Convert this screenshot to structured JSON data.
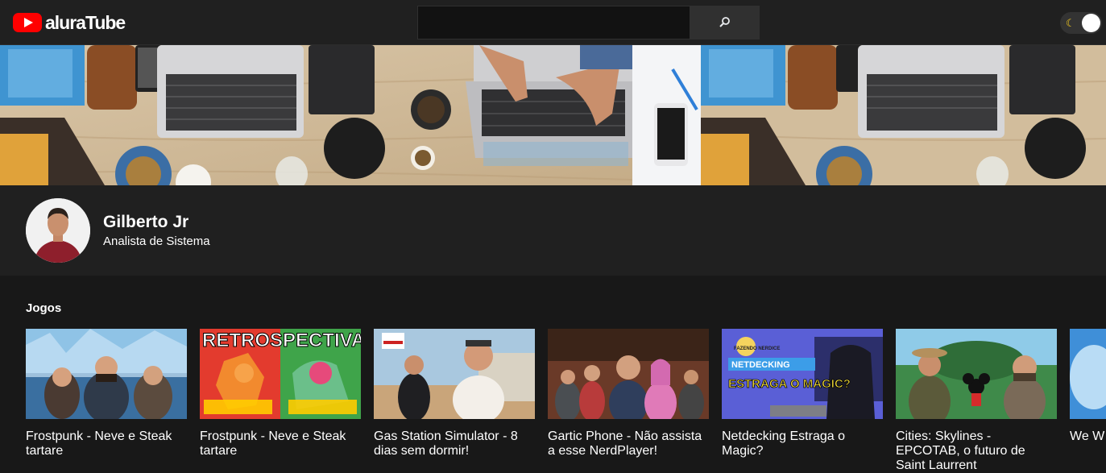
{
  "header": {
    "logo_text": "aluraTube",
    "search": {
      "value": "",
      "placeholder": ""
    },
    "search_icon": "magnifier-icon",
    "theme_toggle": {
      "icon": "moon-icon",
      "state": "dark"
    }
  },
  "profile": {
    "name": "Gilberto Jr",
    "job": "Analista de Sistema"
  },
  "playlists": [
    {
      "title": "Jogos",
      "videos": [
        {
          "title": "Frostpunk - Neve e Steak tartare"
        },
        {
          "title": "Frostpunk - Neve e Steak tartare"
        },
        {
          "title": "Gas Station Simulator - 8 dias sem dormir!"
        },
        {
          "title": "Gartic Phone - Não assista a esse NerdPlayer!"
        },
        {
          "title": "Netdecking Estraga o Magic?"
        },
        {
          "title": "Cities: Skylines - EPCOTAB, o futuro de Saint Laurrent"
        },
        {
          "title": "We W - Os E Mund"
        }
      ]
    }
  ],
  "thumbnails": {
    "retro_text": "RETROSPECTIVA",
    "netdecking_text": {
      "top": "FAZENDO NERDICE",
      "banner": "NETDECKING",
      "big": "ESTRAGA O MAGIC?"
    }
  },
  "colors": {
    "brand_red": "#ff0000",
    "bg": "#181818",
    "surface": "#202020"
  }
}
